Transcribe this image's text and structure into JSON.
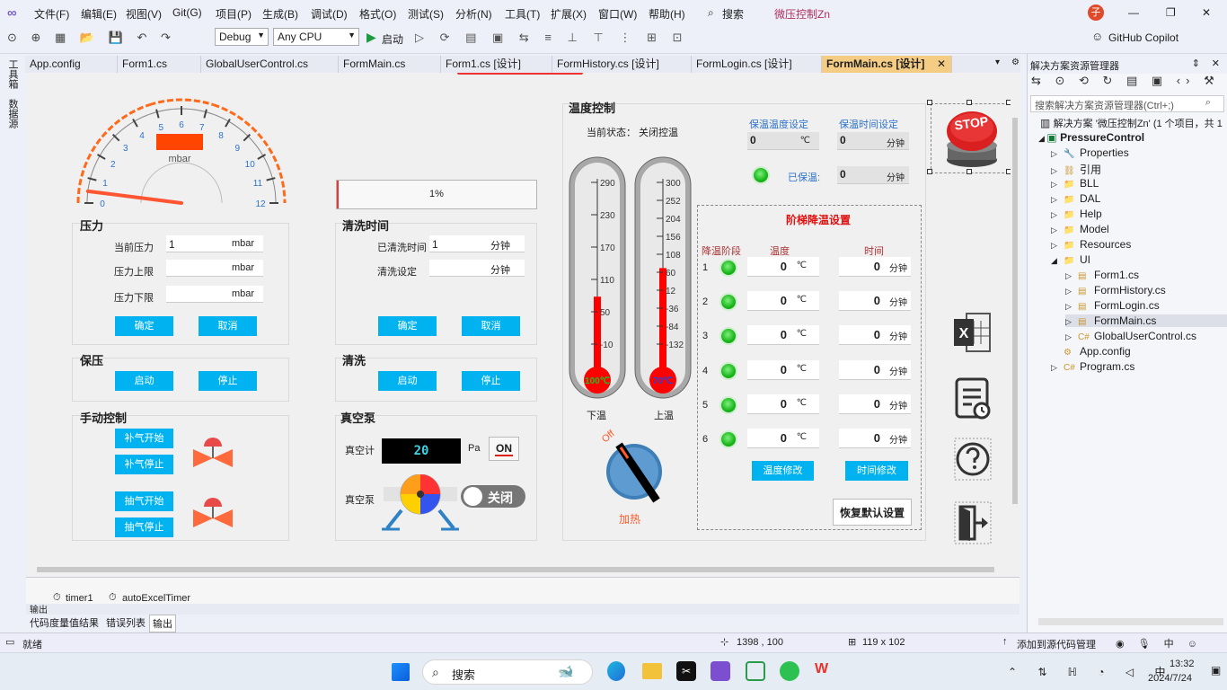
{
  "menu": {
    "file": "文件(F)",
    "edit": "编辑(E)",
    "view": "视图(V)",
    "git": "Git(G)",
    "project": "项目(P)",
    "build": "生成(B)",
    "debug": "调试(D)",
    "format": "格式(O)",
    "test": "测试(S)",
    "analyze": "分析(N)",
    "tools": "工具(T)",
    "ext": "扩展(X)",
    "window": "窗口(W)",
    "help": "帮助(H)",
    "search": "搜索",
    "solution_title": "微压控制Zn",
    "avatar": "子"
  },
  "toolbar": {
    "config": "Debug",
    "platform": "Any CPU",
    "start": "启动",
    "copilot": "GitHub Copilot"
  },
  "left_tabs": {
    "toolbox": "工具箱",
    "datasource": "数据源"
  },
  "tabs": [
    "App.config",
    "Form1.cs",
    "GlobalUserControl.cs",
    "FormMain.cs",
    "Form1.cs [设计]",
    "FormHistory.cs [设计]",
    "FormLogin.cs [设计]",
    "FormMain.cs [设计]"
  ],
  "gauge": {
    "unit": "mbar",
    "ticks": [
      "0",
      "1",
      "2",
      "3",
      "4",
      "5",
      "6",
      "7",
      "8",
      "9",
      "10",
      "11",
      "12"
    ],
    "value_fraction": 0.04
  },
  "progress": {
    "text": "1%",
    "value": 0.01
  },
  "pressure": {
    "title": "压力",
    "current_label": "当前压力",
    "current_value": "1",
    "upper_label": "压力上限",
    "lower_label": "压力下限",
    "unit": "mbar",
    "ok": "确定",
    "cancel": "取消"
  },
  "clean_time": {
    "title": "清洗时间",
    "elapsed_label": "已清洗时间",
    "elapsed_value": "1",
    "set_label": "清洗设定",
    "unit": "分钟",
    "ok": "确定",
    "cancel": "取消"
  },
  "hold": {
    "title": "保压",
    "start": "启动",
    "stop": "停止"
  },
  "clean": {
    "title": "清洗",
    "start": "启动",
    "stop": "停止"
  },
  "manual": {
    "title": "手动控制",
    "fill_start": "补气开始",
    "fill_stop": "补气停止",
    "pump_start": "抽气开始",
    "pump_stop": "抽气停止"
  },
  "vacuum": {
    "title": "真空泵",
    "gauge_label": "真空计",
    "gauge_value": "20",
    "unit": "Pa",
    "pump_label": "真空泵",
    "on_label": "ON",
    "toggle_label": "关闭"
  },
  "temp": {
    "title": "温度控制",
    "status": "当前状态： 关闭控温",
    "hold_temp_label": "保温温度设定",
    "hold_time_label": "保温时间设定",
    "hold_temp_value": "0",
    "hold_temp_unit": "℃",
    "hold_time_value": "0",
    "hold_time_unit": "分钟",
    "held_label": "已保温:",
    "held_value": "0",
    "held_unit": "分钟",
    "lower_label": "下温",
    "upper_label": "上温",
    "lower_reading": "100℃",
    "upper_reading": "70℃",
    "lower_scale": [
      "290",
      "230",
      "170",
      "110",
      "50",
      "-10"
    ],
    "upper_scale": [
      "300",
      "252",
      "204",
      "156",
      "108",
      "60",
      "12",
      "-36",
      "-84",
      "-132"
    ],
    "lower_fill": 0.4,
    "upper_fill": 0.55,
    "knob_off": "Off",
    "knob_label": "加热"
  },
  "step": {
    "title": "阶梯降温设置",
    "col_stage": "降温阶段",
    "col_temp": "温度",
    "col_time": "时间",
    "rows": [
      {
        "n": "1",
        "t": "0",
        "m": "0"
      },
      {
        "n": "2",
        "t": "0",
        "m": "0"
      },
      {
        "n": "3",
        "t": "0",
        "m": "0"
      },
      {
        "n": "4",
        "t": "0",
        "m": "0"
      },
      {
        "n": "5",
        "t": "0",
        "m": "0"
      },
      {
        "n": "6",
        "t": "0",
        "m": "0"
      }
    ],
    "temp_unit": "℃",
    "time_unit": "分钟",
    "temp_btn": "温度修改",
    "time_btn": "时间修改",
    "reset_btn": "恢复默认设置"
  },
  "stop_label": "STOP",
  "components": {
    "timer1": "timer1",
    "timer2": "autoExcelTimer"
  },
  "output": {
    "title": "输出",
    "tabs": [
      "代码度量值结果",
      "错误列表",
      "输出"
    ]
  },
  "explorer": {
    "title": "解决方案资源管理器",
    "search": "搜索解决方案资源管理器(Ctrl+;)",
    "solution": "解决方案 '微压控制Zn' (1 个项目，共 1",
    "project": "PressureControl",
    "items": [
      {
        "d": 1,
        "t": "Properties"
      },
      {
        "d": 1,
        "t": "引用"
      },
      {
        "d": 1,
        "t": "BLL"
      },
      {
        "d": 1,
        "t": "DAL"
      },
      {
        "d": 1,
        "t": "Help"
      },
      {
        "d": 1,
        "t": "Model"
      },
      {
        "d": 1,
        "t": "Resources"
      },
      {
        "d": 1,
        "t": "UI"
      },
      {
        "d": 2,
        "t": "Form1.cs"
      },
      {
        "d": 2,
        "t": "FormHistory.cs"
      },
      {
        "d": 2,
        "t": "FormLogin.cs"
      },
      {
        "d": 2,
        "t": "FormMain.cs"
      },
      {
        "d": 2,
        "t": "GlobalUserControl.cs"
      },
      {
        "d": 1,
        "t": "App.config"
      },
      {
        "d": 1,
        "t": "Program.cs"
      }
    ]
  },
  "status": {
    "ready": "就绪",
    "pos": "1398 , 100",
    "size": "119 x 102",
    "source": "添加到源代码管理"
  },
  "taskbar": {
    "search": "搜索",
    "time": "13:32",
    "date": "2024/7/24"
  },
  "colors": {
    "accent_button": "#00b3f0",
    "thermo_red": "#ff0000",
    "led_green": "#17b517",
    "stop_red": "#d91f1f",
    "gauge_orange": "#ff6a1a"
  }
}
